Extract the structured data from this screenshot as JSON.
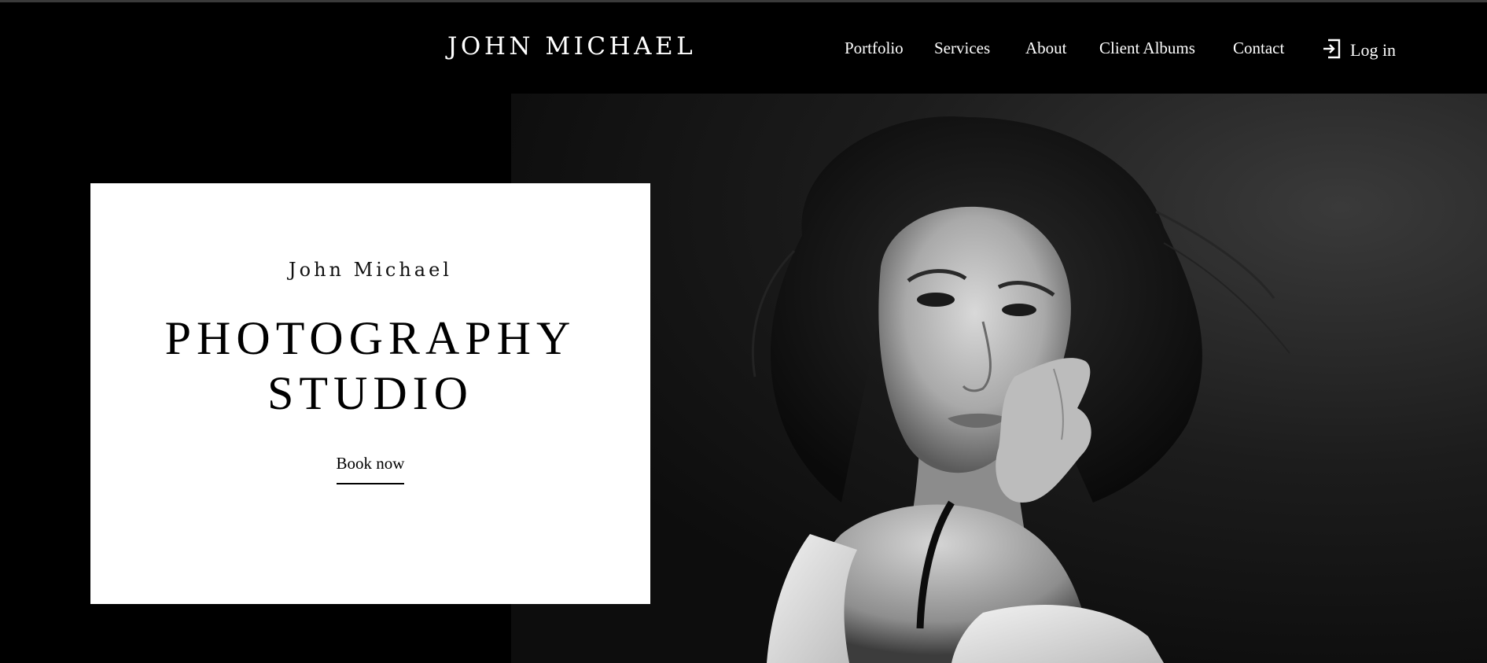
{
  "header": {
    "brand": "JOHN MICHAEL",
    "nav": {
      "portfolio": "Portfolio",
      "services": "Services",
      "about": "About",
      "client_albums": "Client Albums",
      "contact": "Contact"
    },
    "login": {
      "label": "Log in",
      "icon": "login-icon"
    }
  },
  "hero": {
    "eyebrow": "John Michael",
    "title_line1": "PHOTOGRAPHY",
    "title_line2": "STUDIO",
    "cta": "Book now",
    "photo": "black-and-white-portrait-woman-icon"
  },
  "colors": {
    "background": "#000000",
    "text": "#ffffff",
    "card": "#ffffff",
    "card_text": "#000000"
  }
}
